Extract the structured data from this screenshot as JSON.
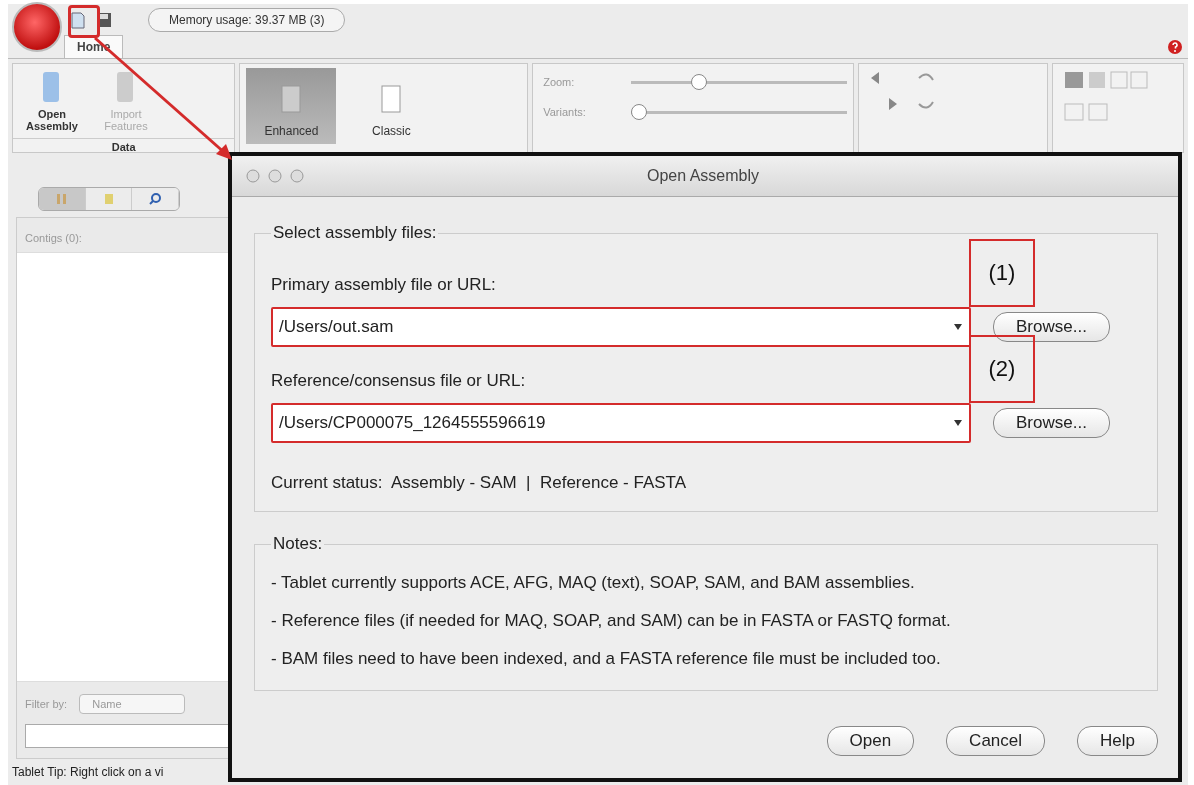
{
  "toolbar": {
    "memory_usage": "Memory usage: 39.37 MB (3)"
  },
  "tabs": [
    {
      "label": "Home",
      "selected": true
    }
  ],
  "ribbon": {
    "data_group": {
      "label": "Data",
      "buttons": [
        {
          "label": "Open Assembly",
          "disabled": false
        },
        {
          "label": "Import Features",
          "disabled": true
        }
      ]
    },
    "styles": [
      {
        "label": "Enhanced",
        "selected": true
      },
      {
        "label": "Classic",
        "selected": false
      }
    ],
    "sliders": [
      {
        "label": "Zoom:",
        "level": 0.3
      },
      {
        "label": "Variants:",
        "level": 0
      }
    ]
  },
  "contigs_panel": {
    "heading": "Contigs (0):",
    "filter_label": "Filter by:",
    "filter_value": "Name"
  },
  "status_bar": "Tablet Tip: Right click on a vi",
  "dialog": {
    "title": "Open Assembly",
    "files_group": "Select assembly files:",
    "fields": [
      {
        "label": "Primary assembly file or URL:",
        "value": "/Users/out.sam",
        "button": "Browse..."
      },
      {
        "label": "Reference/consensus file or URL:",
        "value": "/Users/CP000075_1264555596619",
        "button": "Browse..."
      }
    ],
    "status": "Current status:  Assembly - SAM  |  Reference - FASTA",
    "notes_group": "Notes:",
    "notes": [
      "- Tablet currently supports ACE, AFG, MAQ (text), SOAP, SAM, and BAM assemblies.",
      "- Reference files (if needed for MAQ, SOAP, and SAM) can be in FASTA or FASTQ format.",
      "- BAM files need to have been indexed, and a FASTA reference file must be included too."
    ],
    "buttons": [
      "Open",
      "Cancel",
      "Help"
    ]
  },
  "annotations": [
    "(1)",
    "(2)"
  ]
}
